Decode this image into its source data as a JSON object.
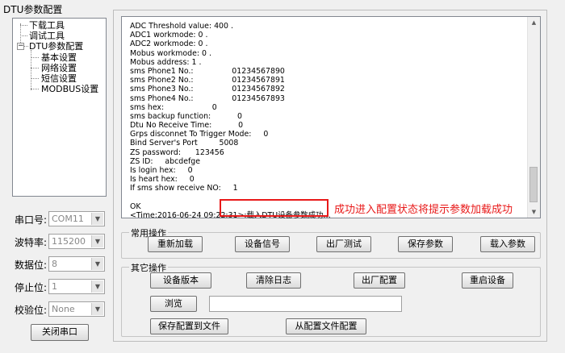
{
  "window": {
    "title": "DTU参数配置"
  },
  "tree": {
    "items": [
      {
        "label": "下载工具"
      },
      {
        "label": "调试工具"
      },
      {
        "label": "DTU参数配置",
        "expander": "−"
      },
      {
        "label": "基本设置"
      },
      {
        "label": "网络设置"
      },
      {
        "label": "短信设置"
      },
      {
        "label": "MODBUS设置"
      }
    ]
  },
  "serial": {
    "port_label": "串口号:",
    "port_value": "COM11",
    "baud_label": "波特率:",
    "baud_value": "115200",
    "databits_label": "数据位:",
    "databits_value": "8",
    "stopbits_label": "停止位:",
    "stopbits_value": "1",
    "parity_label": "校验位:",
    "parity_value": "None",
    "close_button": "关闭串口"
  },
  "log": {
    "lines": [
      "ADC Threshold value: 400 .",
      "ADC1 workmode: 0 .",
      "ADC2 workmode: 0 .",
      "Mobus workmode: 0 .",
      "Mobus address: 1 .",
      "sms Phone1 No.:                01234567890",
      "sms Phone2 No.:                01234567891",
      "sms Phone3 No.:                01234567892",
      "sms Phone4 No.:                01234567893",
      "sms hex:                    0",
      "sms backup function:           0",
      "Dtu No Receive Time:           0",
      "Grps disconnet To Trigger Mode:     0",
      "Bind Server's Port         5008",
      "ZS password:      123456",
      "ZS ID:     abcdefge",
      "Is login hex:     0",
      "Is heart hex:     0",
      "If sms show receive NO:     1",
      "",
      "OK",
      "<Time:2016-06-24 09:22:31>:载入DTU设备参数成功…"
    ]
  },
  "annotation": "成功进入配置状态将提示参数加载成功",
  "common_ops": {
    "title": "常用操作",
    "reload": "重新加载",
    "signal": "设备信号",
    "factory_test": "出厂测试",
    "save_params": "保存参数",
    "load_params": "载入参数"
  },
  "other_ops": {
    "title": "其它操作",
    "version": "设备版本",
    "clear_log": "清除日志",
    "factory_config": "出厂配置",
    "restart": "重启设备",
    "browse": "浏览",
    "file_path": "",
    "save_to_file": "保存配置到文件",
    "load_from_file": "从配置文件配置"
  },
  "colors": {
    "annotation": "#e81919",
    "highlight_border": "#e81919"
  }
}
